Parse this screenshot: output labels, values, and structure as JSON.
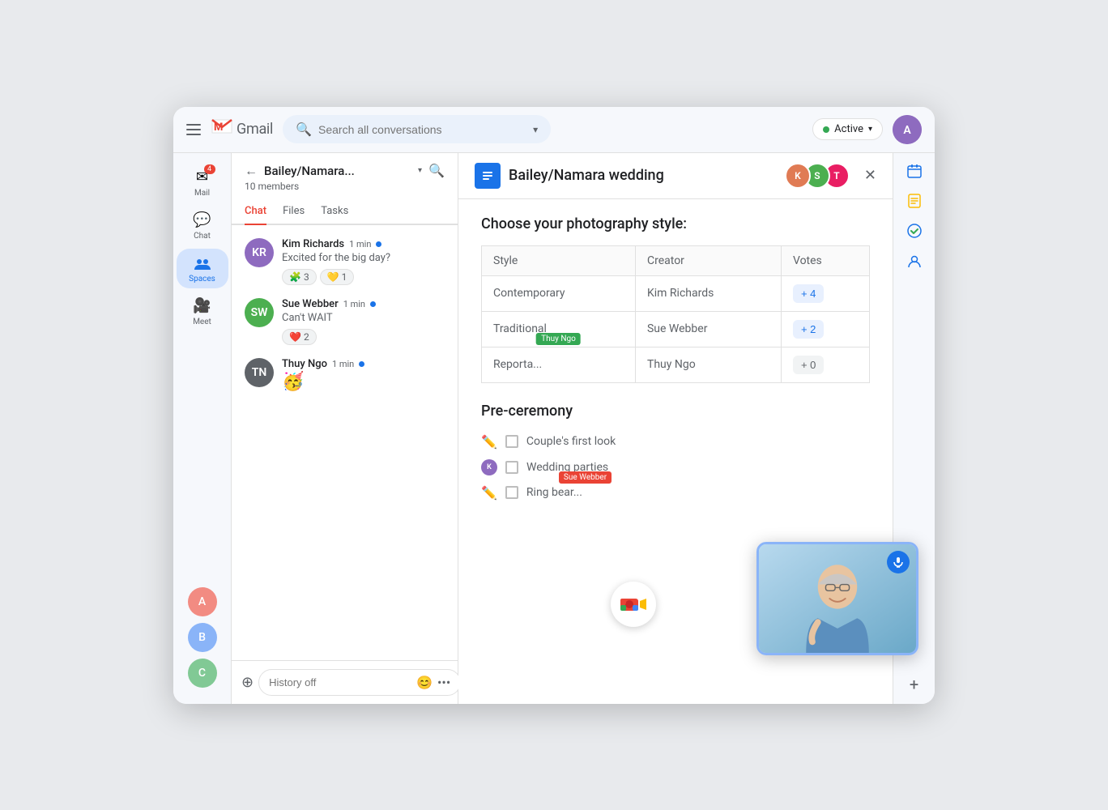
{
  "topbar": {
    "menu_label": "Main menu",
    "app_name": "Gmail",
    "search_placeholder": "Search all conversations",
    "active_label": "Active",
    "active_dot_color": "#34a853"
  },
  "sidebar": {
    "items": [
      {
        "id": "mail",
        "label": "Mail",
        "icon": "✉",
        "badge": "4",
        "active": false
      },
      {
        "id": "chat",
        "label": "Chat",
        "icon": "💬",
        "active": false
      },
      {
        "id": "spaces",
        "label": "Spaces",
        "icon": "👥",
        "active": true
      },
      {
        "id": "meet",
        "label": "Meet",
        "icon": "🎥",
        "active": false
      }
    ],
    "user_avatars": [
      {
        "id": "user1",
        "color": "#f28b82",
        "initials": "A"
      },
      {
        "id": "user2",
        "color": "#8ab4f8",
        "initials": "B"
      }
    ]
  },
  "chat_panel": {
    "back_label": "←",
    "space_title": "Bailey/Namara...",
    "members_count": "10 members",
    "tabs": [
      {
        "id": "chat",
        "label": "Chat",
        "active": true
      },
      {
        "id": "files",
        "label": "Files",
        "active": false
      },
      {
        "id": "tasks",
        "label": "Tasks",
        "active": false
      }
    ],
    "messages": [
      {
        "id": "msg1",
        "sender": "Kim Richards",
        "avatar_color": "#8e6bbf",
        "initials": "KR",
        "time": "1 min",
        "online": true,
        "text": "Excited for the big day?",
        "reactions": [
          {
            "emoji": "🧩",
            "count": "3"
          },
          {
            "emoji": "💛",
            "count": "1"
          }
        ]
      },
      {
        "id": "msg2",
        "sender": "Sue Webber",
        "avatar_color": "#4caf50",
        "initials": "SW",
        "time": "1 min",
        "online": true,
        "text": "Can't WAIT",
        "reactions": [
          {
            "emoji": "❤️",
            "count": "2"
          }
        ]
      },
      {
        "id": "msg3",
        "sender": "Thuy Ngo",
        "avatar_color": "#5f6368",
        "initials": "TN",
        "time": "1 min",
        "online": true,
        "text": "🥳",
        "reactions": []
      }
    ],
    "input_placeholder": "History off",
    "add_label": "+",
    "send_label": "▶"
  },
  "doc_panel": {
    "icon_label": "≡",
    "title": "Bailey/Namara wedding",
    "close_label": "✕",
    "avatars": [
      {
        "color": "#e07b54",
        "initials": "K"
      },
      {
        "color": "#4caf50",
        "initials": "S"
      },
      {
        "color": "#e91e63",
        "initials": "T"
      }
    ],
    "poll": {
      "title": "Choose your photography style:",
      "columns": [
        "Style",
        "Creator",
        "Votes"
      ],
      "rows": [
        {
          "style": "Contemporary",
          "creator": "Kim Richards",
          "votes": "+ 4",
          "vote_style": "blue",
          "cursor": null
        },
        {
          "style": "Traditional",
          "creator": "Sue Webber",
          "votes": "+ 2",
          "vote_style": "blue",
          "cursor": null
        },
        {
          "style": "Reporta...",
          "creator": "Thuy Ngo",
          "votes": "+ 0",
          "vote_style": "grey",
          "cursor": "Thuy Ngo"
        }
      ]
    },
    "preceremon": {
      "title": "Pre-ceremony",
      "items": [
        {
          "icon": "✏",
          "checked": false,
          "text": "Couple's first look",
          "cursor": null,
          "cursor_color": null
        },
        {
          "icon": "👤",
          "checked": false,
          "text": "Wedding parties",
          "cursor": null,
          "cursor_color": null
        },
        {
          "icon": "✏",
          "checked": false,
          "text": "Ring bear...",
          "cursor": "Sue Webber",
          "cursor_color": "#ea4335"
        }
      ]
    }
  },
  "right_panel": {
    "icons": [
      {
        "id": "calendar",
        "label": "Calendar",
        "symbol": "📅"
      },
      {
        "id": "notes",
        "label": "Notes",
        "symbol": "📝"
      },
      {
        "id": "tasks",
        "label": "Tasks",
        "symbol": "✓"
      },
      {
        "id": "contacts",
        "label": "Contacts",
        "symbol": "👤"
      }
    ],
    "add_label": "+"
  },
  "video_pip": {
    "mic_icon": "🎤"
  },
  "meet_icon": {
    "label": "Meet"
  }
}
